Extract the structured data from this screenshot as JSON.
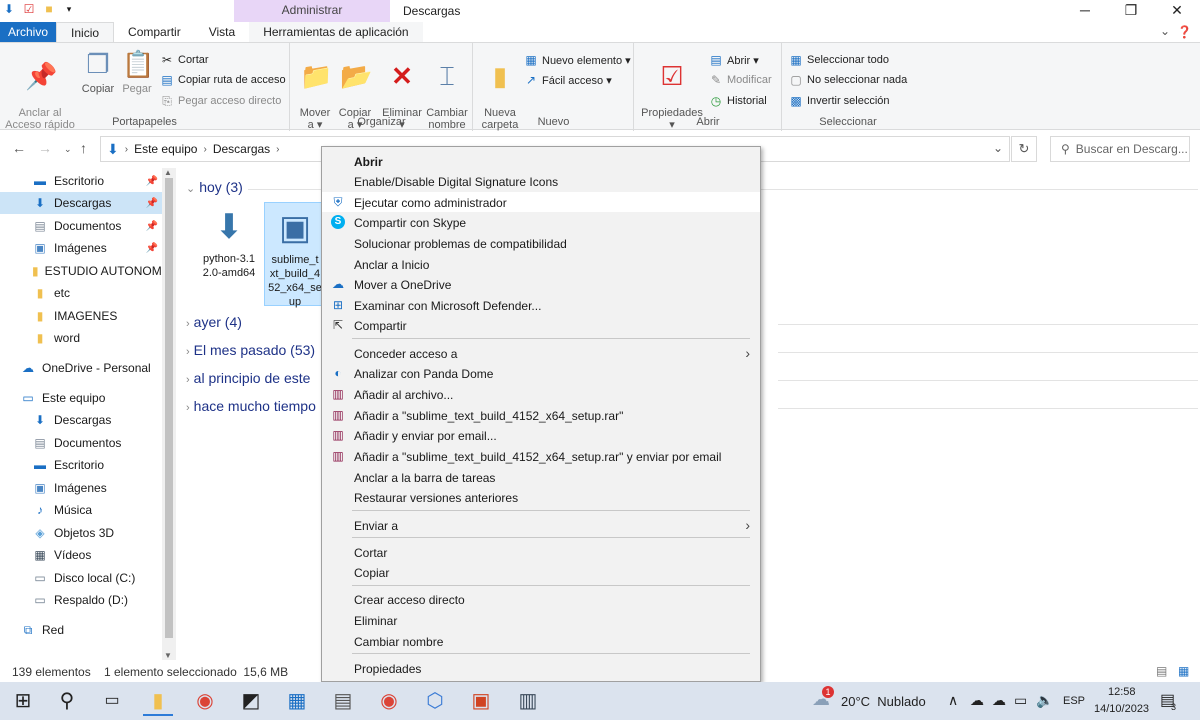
{
  "window": {
    "context_band": "Administrar",
    "title": "Descargas",
    "min": "─",
    "max": "❐",
    "close": "✕"
  },
  "tabs": {
    "file": "Archivo",
    "home": "Inicio",
    "share": "Compartir",
    "view": "Vista",
    "app_tools": "Herramientas de aplicación"
  },
  "ribbon": {
    "portapapeles": {
      "label": "Portapapeles",
      "pin": "Anclar al\nAcceso rápido",
      "copy": "Copiar",
      "paste": "Pegar",
      "cut": "Cortar",
      "copy_path": "Copiar ruta de acceso",
      "paste_shortcut": "Pegar acceso directo"
    },
    "organizar": {
      "label": "Organizar",
      "move": "Mover\na ▾",
      "copy_to": "Copiar\na ▾",
      "delete": "Eliminar\n▾",
      "rename": "Cambiar\nnombre"
    },
    "nuevo": {
      "label": "Nuevo",
      "new_folder": "Nueva\ncarpeta",
      "new_item": "Nuevo elemento ▾",
      "easy_access": "Fácil acceso ▾"
    },
    "abrir": {
      "label": "Abrir",
      "properties": "Propiedades\n▾",
      "open": "Abrir ▾",
      "edit": "Modificar",
      "history": "Historial"
    },
    "seleccionar": {
      "label": "Seleccionar",
      "select_all": "Seleccionar todo",
      "select_none": "No seleccionar nada",
      "invert": "Invertir selección"
    }
  },
  "address": {
    "crumb1": "Este equipo",
    "crumb2": "Descargas",
    "search_placeholder": "Buscar en Descarg..."
  },
  "nav": {
    "items": [
      {
        "label": "Escritorio"
      },
      {
        "label": "Descargas"
      },
      {
        "label": "Documentos"
      },
      {
        "label": "Imágenes"
      },
      {
        "label": "ESTUDIO AUTONOMO"
      },
      {
        "label": "etc"
      },
      {
        "label": "IMAGENES"
      },
      {
        "label": "word"
      },
      {
        "label": "OneDrive - Personal"
      },
      {
        "label": "Este equipo"
      },
      {
        "label": "Descargas"
      },
      {
        "label": "Documentos"
      },
      {
        "label": "Escritorio"
      },
      {
        "label": "Imágenes"
      },
      {
        "label": "Música"
      },
      {
        "label": "Objetos 3D"
      },
      {
        "label": "Vídeos"
      },
      {
        "label": "Disco local (C:)"
      },
      {
        "label": "Respaldo (D:)"
      },
      {
        "label": "Red"
      }
    ]
  },
  "content": {
    "groups": [
      {
        "label": "hoy (3)"
      },
      {
        "label": "ayer (4)"
      },
      {
        "label": "El mes pasado (53)"
      },
      {
        "label": "al principio de este"
      },
      {
        "label": "hace mucho tiempo"
      }
    ],
    "files": [
      {
        "name": "python-3.1\n2.0-amd64"
      },
      {
        "name": "sublime_t\nxt_build_4\n52_x64_se\nup"
      }
    ]
  },
  "status": {
    "count": "139 elementos",
    "selected": "1 elemento seleccionado  15,6 MB"
  },
  "menu": {
    "items": [
      {
        "label": "Abrir"
      },
      {
        "label": "Enable/Disable Digital Signature Icons"
      },
      {
        "label": "Ejecutar como administrador"
      },
      {
        "label": "Compartir con Skype"
      },
      {
        "label": "Solucionar problemas de compatibilidad"
      },
      {
        "label": "Anclar a Inicio"
      },
      {
        "label": "Mover a OneDrive"
      },
      {
        "label": "Examinar con Microsoft Defender..."
      },
      {
        "label": "Compartir"
      },
      {
        "label": "Conceder acceso a"
      },
      {
        "label": "Analizar con Panda Dome"
      },
      {
        "label": "Añadir al archivo..."
      },
      {
        "label": "Añadir a \"sublime_text_build_4152_x64_setup.rar\""
      },
      {
        "label": "Añadir y enviar por email..."
      },
      {
        "label": "Añadir a \"sublime_text_build_4152_x64_setup.rar\" y enviar por email"
      },
      {
        "label": "Anclar a la barra de tareas"
      },
      {
        "label": "Restaurar versiones anteriores"
      },
      {
        "label": "Enviar a"
      },
      {
        "label": "Cortar"
      },
      {
        "label": "Copiar"
      },
      {
        "label": "Crear acceso directo"
      },
      {
        "label": "Eliminar"
      },
      {
        "label": "Cambiar nombre"
      },
      {
        "label": "Propiedades"
      }
    ]
  },
  "taskbar": {
    "weather": "20°C  Nublado",
    "weather_badge": "1",
    "lang": "ESP",
    "time": "12:58",
    "date": "14/10/2023",
    "notif_count": "3"
  },
  "colors": {
    "accent": "#1a6fc4",
    "context_band": "#e8d6f7",
    "selection": "#cce8ff",
    "folder": "#f0c050"
  }
}
